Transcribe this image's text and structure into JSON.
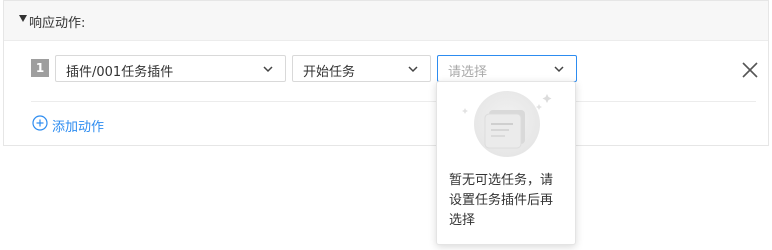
{
  "section": {
    "title": "响应动作:"
  },
  "action_row": {
    "index": "1",
    "plugin_select": {
      "value": "插件/001任务插件"
    },
    "operation_select": {
      "value": "开始任务"
    },
    "task_select": {
      "placeholder": "请选择"
    }
  },
  "add_action_label": "添加动作",
  "dropdown": {
    "empty_message_line1": "暂无可选任务，请",
    "empty_message_line2": "设置任务插件后再",
    "empty_message_line3": "选择"
  },
  "colors": {
    "accent": "#2d8cf0",
    "header_bg": "#f7f7f7",
    "index_badge": "#9e9e9e"
  }
}
